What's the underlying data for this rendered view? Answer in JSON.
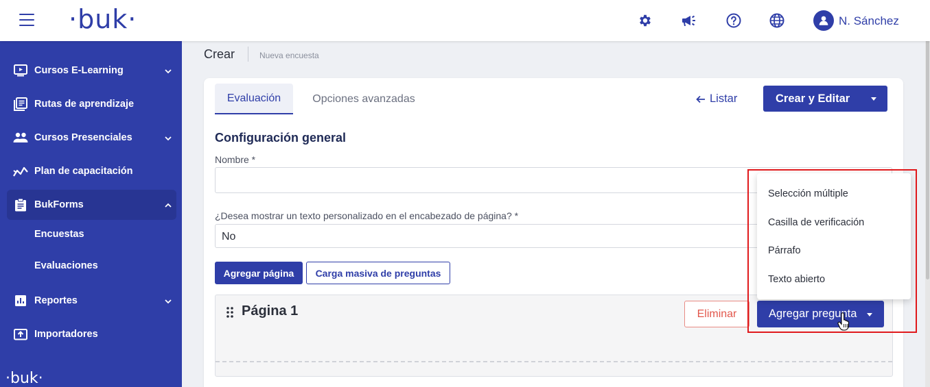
{
  "header": {
    "logo": "·buk·",
    "username": "N. Sánchez",
    "icons": [
      "menu-icon",
      "gear-icon",
      "megaphone-icon",
      "help-icon",
      "globe-icon",
      "user-icon"
    ]
  },
  "sidebar": {
    "items": [
      {
        "label": "Cursos E-Learning",
        "icon": "play-screen-icon",
        "expandable": true
      },
      {
        "label": "Rutas de aprendizaje",
        "icon": "book-list-icon",
        "expandable": false
      },
      {
        "label": "Cursos Presenciales",
        "icon": "people-icon",
        "expandable": true
      },
      {
        "label": "Plan de capacitación",
        "icon": "chart-line-icon",
        "expandable": false
      },
      {
        "label": "BukForms",
        "icon": "clipboard-icon",
        "expandable": true,
        "expanded": true
      },
      {
        "label": "Reportes",
        "icon": "bar-report-icon",
        "expandable": true
      },
      {
        "label": "Importadores",
        "icon": "upload-icon",
        "expandable": false
      }
    ],
    "subitems": [
      "Encuestas",
      "Evaluaciones"
    ],
    "footer_logo": "·buk·"
  },
  "breadcrumb": {
    "main": "Crear",
    "sub": "Nueva encuesta"
  },
  "tabs": [
    {
      "label": "Evaluación",
      "active": true
    },
    {
      "label": "Opciones avanzadas",
      "active": false
    }
  ],
  "toolbar": {
    "list_label": "Listar",
    "create_label": "Crear y Editar"
  },
  "form": {
    "section_title": "Configuración general",
    "name_label": "Nombre *",
    "name_value": "",
    "header_text_label": "¿Desea mostrar un texto personalizado en el encabezado de página? *",
    "header_text_value": "No",
    "add_page_label": "Agregar página",
    "bulk_questions_label": "Carga masiva de preguntas"
  },
  "page": {
    "title": "Página 1",
    "delete_label": "Eliminar",
    "add_question_label": "Agregar pregunta"
  },
  "question_menu": {
    "options": [
      "Selección múltiple",
      "Casilla de verificación",
      "Párrafo",
      "Texto abierto"
    ]
  },
  "colors": {
    "primary": "#2f3ea8",
    "danger": "#e2574c",
    "highlight": "#e0181b"
  }
}
